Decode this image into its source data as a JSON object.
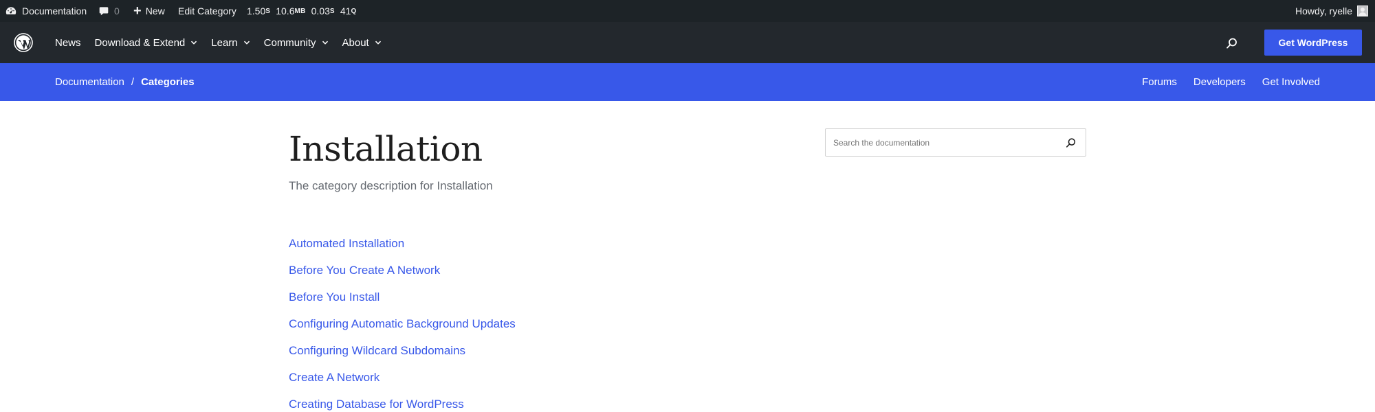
{
  "adminbar": {
    "site_name": "Documentation",
    "comments_count": "0",
    "new_label": "New",
    "edit_label": "Edit Category",
    "stats": [
      {
        "value": "1.50",
        "unit": "S"
      },
      {
        "value": "10.6",
        "unit": "MB"
      },
      {
        "value": "0.03",
        "unit": "S"
      },
      {
        "value": "41",
        "unit": "Q"
      }
    ],
    "greeting": "Howdy, ryelle"
  },
  "nav": {
    "items": [
      {
        "label": "News",
        "has_dropdown": false
      },
      {
        "label": "Download & Extend",
        "has_dropdown": true
      },
      {
        "label": "Learn",
        "has_dropdown": true
      },
      {
        "label": "Community",
        "has_dropdown": true
      },
      {
        "label": "About",
        "has_dropdown": true
      }
    ],
    "cta_label": "Get WordPress"
  },
  "localnav": {
    "breadcrumb": [
      "Documentation",
      "Categories"
    ],
    "separator": "/",
    "links": [
      "Forums",
      "Developers",
      "Get Involved"
    ]
  },
  "page": {
    "title": "Installation",
    "description": "The category description for Installation"
  },
  "search": {
    "placeholder": "Search the documentation"
  },
  "articles": [
    "Automated Installation",
    "Before You Create A Network",
    "Before You Install",
    "Configuring Automatic Background Updates",
    "Configuring Wildcard Subdomains",
    "Create A Network",
    "Creating Database for WordPress"
  ],
  "colors": {
    "adminbar_bg": "#1d2327",
    "nav_bg": "#23282d",
    "accent": "#3858e9",
    "description": "#656a71"
  }
}
